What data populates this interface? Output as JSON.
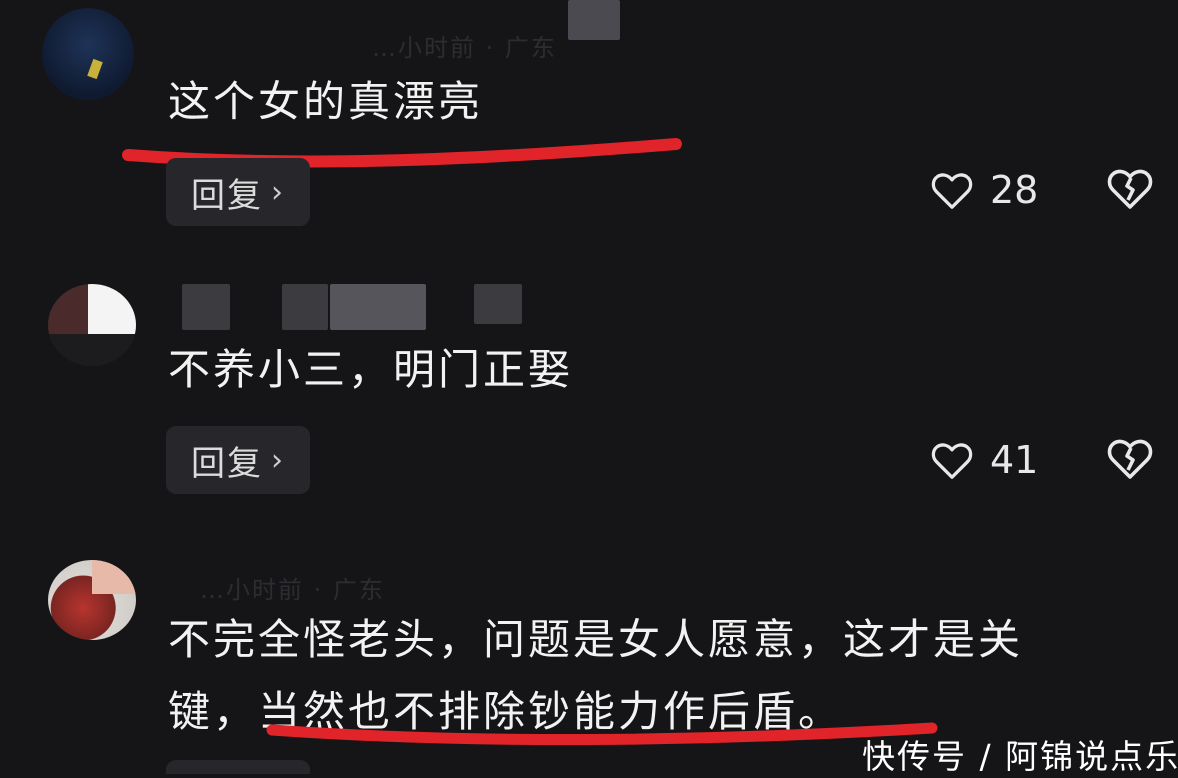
{
  "comments": [
    {
      "meta": "…小时前 · 广东",
      "text": "这个女的真漂亮",
      "reply_label": "回复",
      "likes": "28"
    },
    {
      "meta": "",
      "text": "不养小三，明门正娶",
      "reply_label": "回复",
      "likes": "41"
    },
    {
      "meta": "…小时前 · 广东",
      "text_line1": "不完全怪老头，问题是女人愿意，这才是关",
      "text_line2": "键，当然也不排除钞能力作后盾。"
    }
  ],
  "watermark": "快传号 / 阿锦说点乐",
  "colors": {
    "background": "#151518",
    "underline": "#e0242a",
    "reply_bg": "#26262b"
  },
  "icons": [
    "heart-outline-icon",
    "broken-heart-icon",
    "chevron-right-icon"
  ]
}
